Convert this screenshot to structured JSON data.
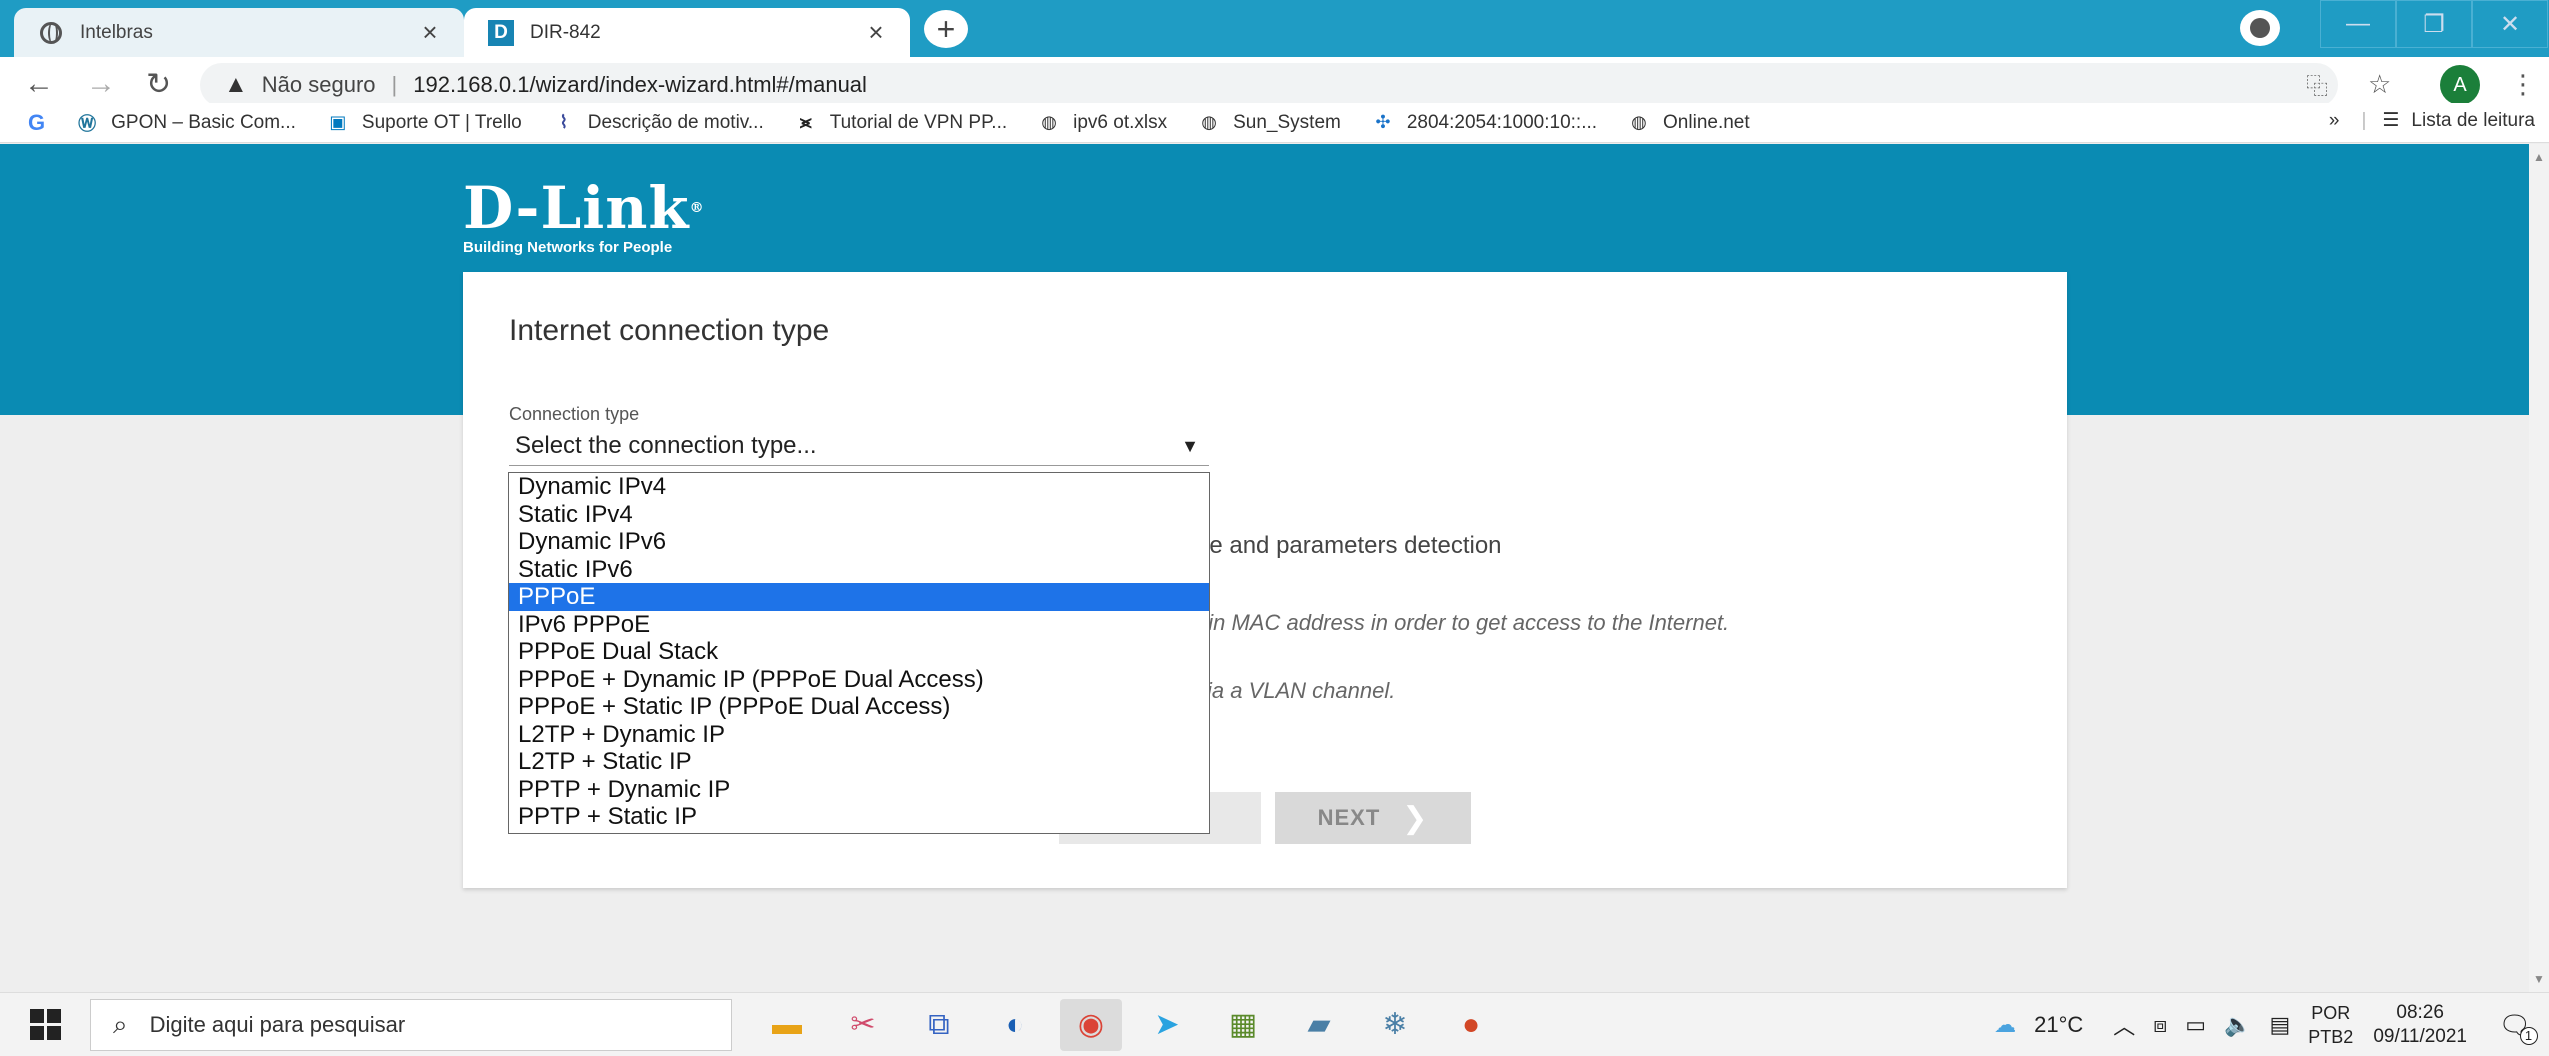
{
  "browser": {
    "tabs": [
      {
        "title": "Intelbras",
        "active": false
      },
      {
        "title": "DIR-842",
        "active": true
      }
    ],
    "new_tab_symbol": "+",
    "close_symbol": "×",
    "security_label": "Não seguro",
    "url_host": "192.168.0.1",
    "url_path": "/wizard/index-wizard.html#/manual",
    "avatar_letter": "A",
    "bookmarks": [
      "GPON – Basic Com...",
      "Suporte OT | Trello",
      "Descrição de motiv...",
      "Tutorial de VPN PP...",
      "ipv6 ot.xlsx",
      "Sun_System",
      "2804:2054:1000:10::...",
      "Online.net"
    ],
    "reading_list": "Lista de leitura",
    "icons": {
      "back": "arrow-left-icon",
      "forward": "arrow-right-icon",
      "reload": "reload-icon",
      "translate": "translate-icon",
      "bookmark_star": "star-icon",
      "menu": "kebab-menu-icon"
    }
  },
  "page": {
    "logo_word": "D-Link",
    "logo_tagline": "Building Networks for People",
    "card_title": "Internet connection type",
    "field_label": "Connection type",
    "select_placeholder": "Select the connection type...",
    "bg_line1": "pe and parameters detection",
    "bg_line2": "ain MAC address in order to get access to the Internet.",
    "bg_line3": "via a VLAN channel.",
    "next_label": "NEXT",
    "dropdown_options": [
      "Dynamic IPv4",
      "Static IPv4",
      "Dynamic IPv6",
      "Static IPv6",
      "PPPoE",
      "IPv6 PPPoE",
      "PPPoE Dual Stack",
      "PPPoE + Dynamic IP (PPPoE Dual Access)",
      "PPPoE + Static IP (PPPoE Dual Access)",
      "L2TP + Dynamic IP",
      "L2TP + Static IP",
      "PPTP + Dynamic IP",
      "PPTP + Static IP"
    ],
    "selected_option": "PPPoE",
    "colors": {
      "banner": "#0a8bb3",
      "selected": "#1e73e8",
      "tabstrip": "#1f9cc4"
    }
  },
  "taskbar": {
    "search_placeholder": "Digite aqui para pesquisar",
    "weather": "21°C",
    "lang_line1": "POR",
    "lang_line2": "PTB2",
    "time": "08:26",
    "date": "09/11/2021",
    "notif_count": "1"
  }
}
